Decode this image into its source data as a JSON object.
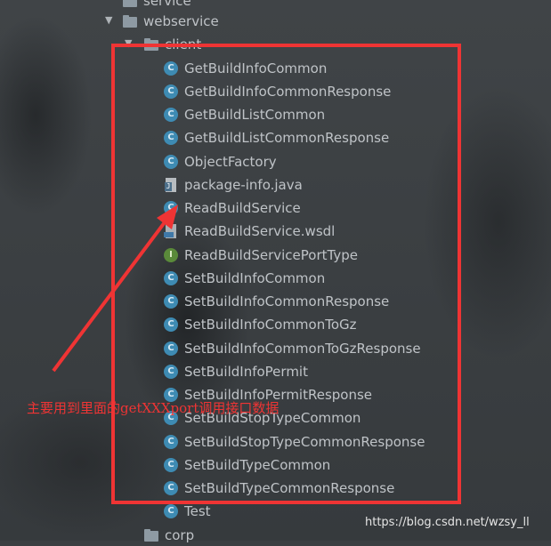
{
  "tree": {
    "service_label": "service",
    "webservice_label": "webservice",
    "client_label": "client",
    "files": [
      {
        "label": "GetBuildInfoCommon",
        "kind": "class"
      },
      {
        "label": "GetBuildInfoCommonResponse",
        "kind": "class"
      },
      {
        "label": "GetBuildListCommon",
        "kind": "class"
      },
      {
        "label": "GetBuildListCommonResponse",
        "kind": "class"
      },
      {
        "label": "ObjectFactory",
        "kind": "class"
      },
      {
        "label": "package-info.java",
        "kind": "java-file"
      },
      {
        "label": "ReadBuildService",
        "kind": "class"
      },
      {
        "label": "ReadBuildService.wsdl",
        "kind": "wsdl-file"
      },
      {
        "label": "ReadBuildServicePortType",
        "kind": "interface"
      },
      {
        "label": "SetBuildInfoCommon",
        "kind": "class"
      },
      {
        "label": "SetBuildInfoCommonResponse",
        "kind": "class"
      },
      {
        "label": "SetBuildInfoCommonToGz",
        "kind": "class"
      },
      {
        "label": "SetBuildInfoCommonToGzResponse",
        "kind": "class"
      },
      {
        "label": "SetBuildInfoPermit",
        "kind": "class"
      },
      {
        "label": "SetBuildInfoPermitResponse",
        "kind": "class"
      },
      {
        "label": "SetBuildStopTypeCommon",
        "kind": "class"
      },
      {
        "label": "SetBuildStopTypeCommonResponse",
        "kind": "class"
      },
      {
        "label": "SetBuildTypeCommon",
        "kind": "class"
      },
      {
        "label": "SetBuildTypeCommonResponse",
        "kind": "class"
      },
      {
        "label": "Test",
        "kind": "class"
      }
    ],
    "corp_label": "corp"
  },
  "icons": {
    "class_letter": "C",
    "interface_letter": "I"
  },
  "annotation": {
    "text": "主要用到里面的getXXXport调用接口数据",
    "color": "#ef3434"
  },
  "watermark": {
    "text": "https://blog.csdn.net/wzsy_ll"
  }
}
